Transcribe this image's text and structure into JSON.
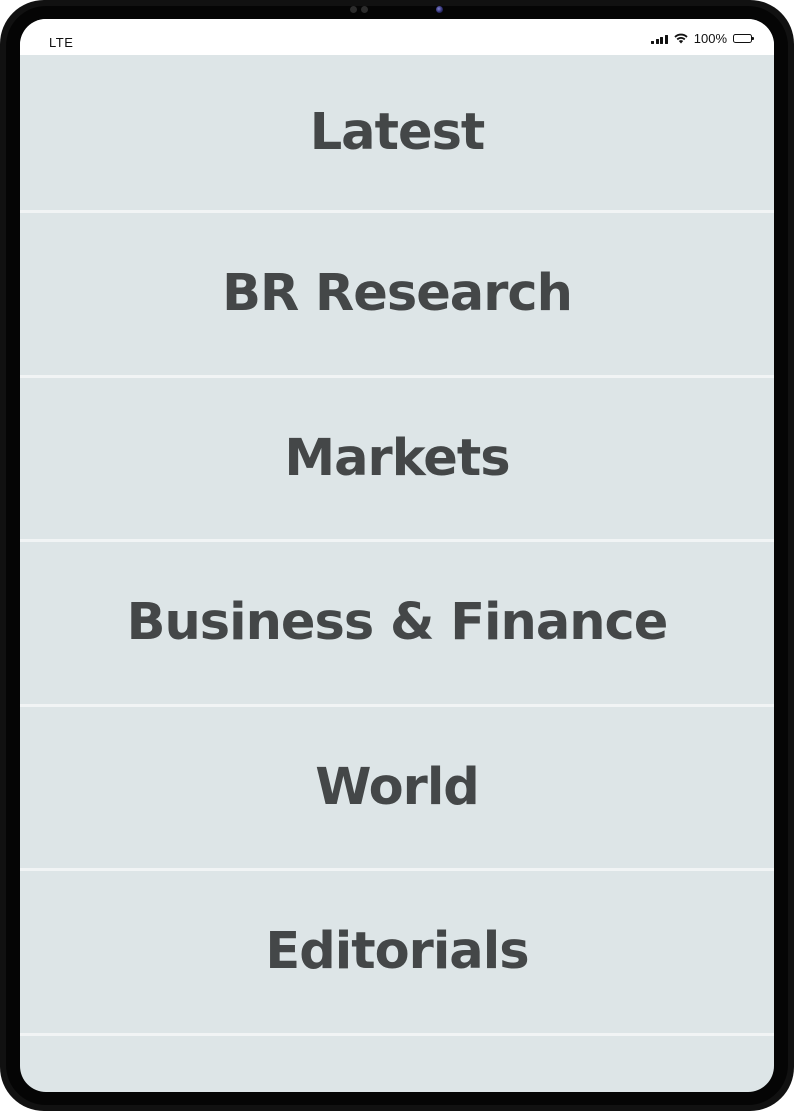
{
  "status_bar": {
    "carrier": "LTE",
    "battery": "100%",
    "icons": [
      "signal-icon",
      "wifi-icon",
      "battery-icon"
    ]
  },
  "menu": {
    "items": [
      {
        "label": "Latest"
      },
      {
        "label": "BR Research"
      },
      {
        "label": "Markets"
      },
      {
        "label": "Business & Finance"
      },
      {
        "label": "World"
      },
      {
        "label": "Editorials"
      }
    ]
  },
  "colors": {
    "background": "#dde5e7",
    "divider": "#f1f4f5",
    "text": "#444748",
    "device_frame": "#111111"
  }
}
